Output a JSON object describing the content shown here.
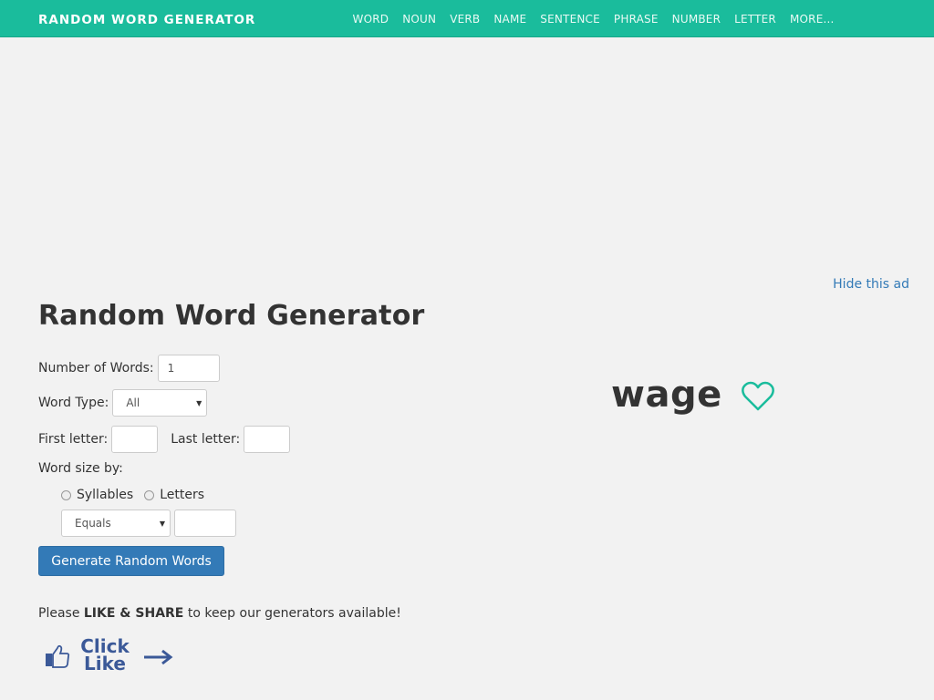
{
  "navbar": {
    "brand": "RANDOM WORD GENERATOR",
    "links": [
      "WORD",
      "NOUN",
      "VERB",
      "NAME",
      "SENTENCE",
      "PHRASE",
      "NUMBER",
      "LETTER",
      "MORE..."
    ],
    "color": "#1abc9c"
  },
  "ad": {
    "hide_label": "Hide this ad"
  },
  "page": {
    "title": "Random Word Generator"
  },
  "form": {
    "num_words_label": "Number of Words:",
    "num_words_value": "1",
    "word_type_label": "Word Type:",
    "word_type_value": "All",
    "first_letter_label": "First letter:",
    "first_letter_value": "",
    "last_letter_label": "Last letter:",
    "last_letter_value": "",
    "size_by_label": "Word size by:",
    "syllables_label": "Syllables",
    "letters_label": "Letters",
    "comparison_value": "Equals",
    "size_value": "",
    "generate_label": "Generate Random Words"
  },
  "share": {
    "prefix": "Please ",
    "bold": "LIKE & SHARE",
    "suffix": " to keep our generators available!",
    "click_like_line1": "Click",
    "click_like_line2": "Like"
  },
  "result": {
    "word": "wage",
    "favorite_icon": "heart-outline-icon"
  }
}
